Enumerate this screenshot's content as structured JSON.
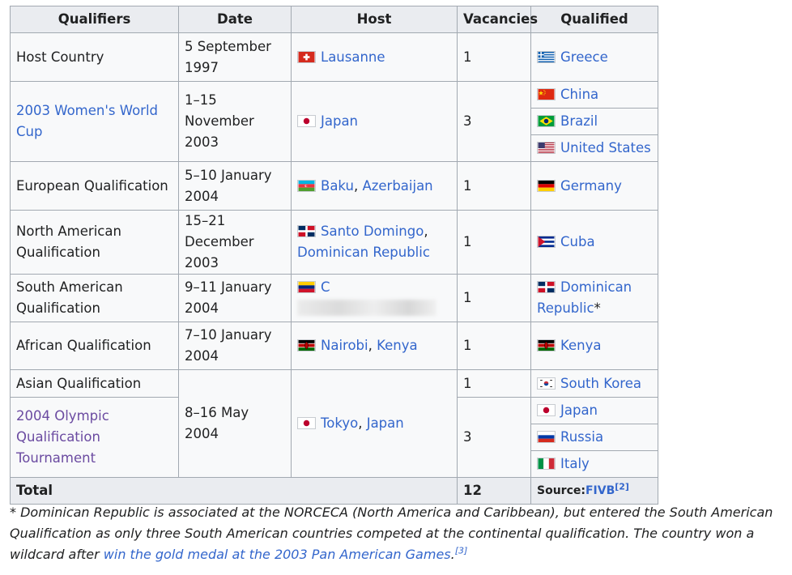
{
  "headers": [
    "Qualifiers",
    "Date",
    "Host",
    "Vacancies",
    "Qualified"
  ],
  "rows": {
    "host_country": {
      "qualifier": "Host Country",
      "date": "5 September 1997",
      "host_city": "Lausanne",
      "vacancies": "1",
      "qualified": [
        "Greece"
      ]
    },
    "world_cup": {
      "qualifier": "2003 Women's World Cup",
      "date": "1–15 November 2003",
      "host_city": "Japan",
      "vacancies": "3",
      "qualified": [
        "China",
        "Brazil",
        "United States"
      ]
    },
    "european": {
      "qualifier": "European Qualification",
      "date": "5–10 January 2004",
      "host_city": "Baku",
      "host_sep": ", ",
      "host_country": "Azerbaijan",
      "vacancies": "1",
      "qualified": [
        "Germany"
      ]
    },
    "north_american": {
      "qualifier": "North American Qualification",
      "date": "15–21 December 2003",
      "host_city": "Santo Domingo",
      "host_sep": ", ",
      "host_country": "Dominican Republic",
      "vacancies": "1",
      "qualified": [
        "Cuba"
      ]
    },
    "south_american": {
      "qualifier": "South American Qualification",
      "date": "9–11 January 2004",
      "host_city": "C",
      "vacancies": "1",
      "qualified": [
        "Dominican Republic"
      ],
      "qualified_suffix": "*"
    },
    "african": {
      "qualifier": "African Qualification",
      "date": "7–10 January 2004",
      "host_city": "Nairobi",
      "host_sep": ", ",
      "host_country": "Kenya",
      "vacancies": "1",
      "qualified": [
        "Kenya"
      ]
    },
    "asian": {
      "qualifier": "Asian Qualification",
      "vacancies": "1",
      "qualified": [
        "South Korea"
      ]
    },
    "olympic_tournament": {
      "qualifier": "2004 Olympic Qualification Tournament",
      "vacancies": "3",
      "qualified": [
        "Japan",
        "Russia",
        "Italy"
      ]
    },
    "shared_asian_oqt": {
      "date": "8–16 May 2004",
      "host_city": "Tokyo",
      "host_sep": ", ",
      "host_country": "Japan"
    }
  },
  "total": {
    "label": "Total",
    "vacancies": "12",
    "source_label": "Source:",
    "source_link": "FIVB",
    "source_ref": "[2]"
  },
  "footnote": {
    "text": "* Dominican Republic is associated at the NORCECA (North America and Caribbean), but entered the South American Qualification as only three South American countries competed at the continental qualification. The country won a wildcard after ",
    "link": "win the gold medal at the 2003 Pan American Games",
    "after": ".",
    "ref": "[3]"
  },
  "colors": {
    "link": "#3366cc",
    "visited_link": "#6b4ba1",
    "header_bg": "#eaecf0",
    "cell_bg": "#f8f9fa",
    "border": "#a2a9b1"
  },
  "flags": {
    "switzerland": "switzerland-flag-icon",
    "greece": "greece-flag-icon",
    "japan": "japan-flag-icon",
    "china": "china-flag-icon",
    "brazil": "brazil-flag-icon",
    "usa": "usa-flag-icon",
    "azerbaijan": "azerbaijan-flag-icon",
    "germany": "germany-flag-icon",
    "dominican_republic": "dominican-republic-flag-icon",
    "cuba": "cuba-flag-icon",
    "venezuela": "venezuela-flag-icon",
    "kenya": "kenya-flag-icon",
    "south_korea": "south-korea-flag-icon",
    "russia": "russia-flag-icon",
    "italy": "italy-flag-icon"
  }
}
